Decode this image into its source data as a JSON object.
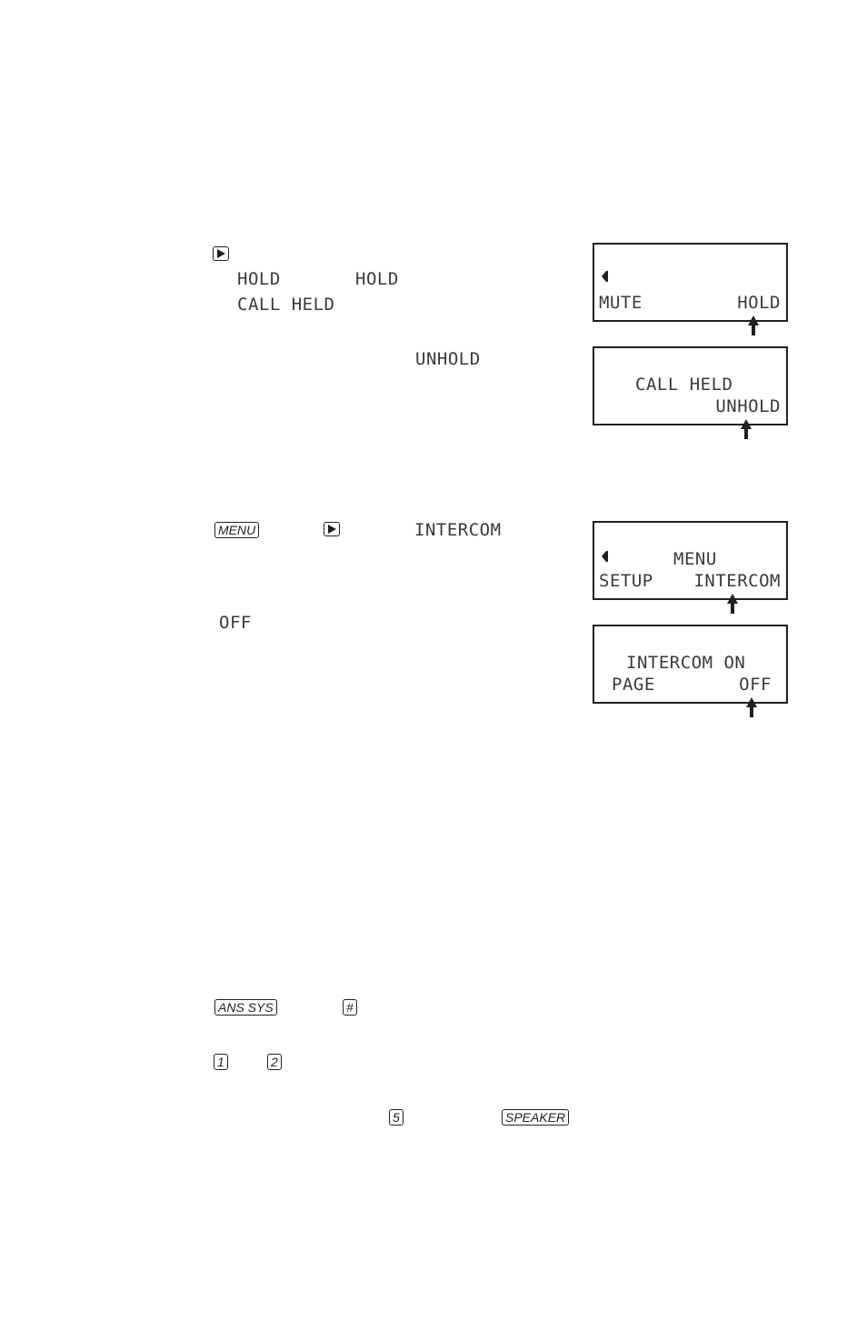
{
  "section_hold": {
    "play_key_icon": "right-triangle-key",
    "inline_lcd_texts": [
      "HOLD",
      "HOLD",
      "CALL HELD",
      "UNHOLD"
    ],
    "screen_1": {
      "indicator_icon": "back-arrow",
      "left_softkey": "MUTE",
      "right_softkey": "HOLD"
    },
    "screen_2": {
      "line_1": "CALL HELD",
      "right_softkey": "UNHOLD"
    }
  },
  "section_intercom": {
    "menu_key": "MENU",
    "play_key_icon": "right-triangle-key",
    "inline_lcd_texts": [
      "INTERCOM",
      "OFF"
    ],
    "screen_1": {
      "indicator_icon": "back-arrow",
      "title": "MENU",
      "left_softkey": "SETUP",
      "right_softkey": "INTERCOM"
    },
    "screen_2": {
      "line_1": "INTERCOM ON",
      "left_softkey": "PAGE",
      "right_softkey": "OFF"
    }
  },
  "section_keys": {
    "ans_sys_key": "ANS SYS",
    "hash_key": "#",
    "key_1": "1",
    "key_2": "2",
    "key_5": "5",
    "speaker_key": "SPEAKER"
  }
}
